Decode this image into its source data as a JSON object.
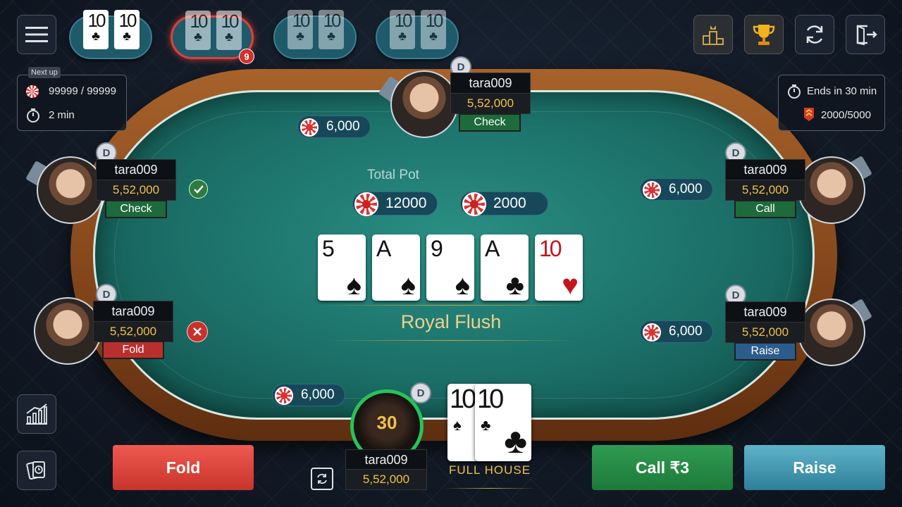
{
  "top_bar": {
    "menu_icon": "hamburger-menu-icon",
    "hands": [
      {
        "cards": [
          {
            "rank": "10",
            "suit": "♣"
          },
          {
            "rank": "10",
            "suit": "♣"
          }
        ],
        "state": "current"
      },
      {
        "cards": [
          {
            "rank": "10",
            "suit": "♣"
          },
          {
            "rank": "10",
            "suit": "♣"
          }
        ],
        "state": "alert",
        "badge": "9"
      },
      {
        "cards": [
          {
            "rank": "10",
            "suit": "♣"
          },
          {
            "rank": "10",
            "suit": "♣"
          }
        ],
        "state": "dim"
      },
      {
        "cards": [
          {
            "rank": "10",
            "suit": "♣"
          },
          {
            "rank": "10",
            "suit": "♣"
          }
        ],
        "state": "dim"
      }
    ],
    "right_icons": [
      "podium-icon",
      "trophy-icon",
      "refresh-icon",
      "exit-icon"
    ]
  },
  "next_up": {
    "label": "Next up",
    "blinds": "99999 / 99999",
    "time": "2 min"
  },
  "tournament": {
    "ends_in": "Ends in 30 min",
    "rank": "2000/5000"
  },
  "pot": {
    "label": "Total Pot",
    "main": "12000",
    "side": "2000"
  },
  "community_cards": [
    {
      "rank": "5",
      "suit": "♠",
      "color": "#111111"
    },
    {
      "rank": "A",
      "suit": "♠",
      "color": "#111111"
    },
    {
      "rank": "9",
      "suit": "♠",
      "color": "#111111"
    },
    {
      "rank": "A",
      "suit": "♣",
      "color": "#111111"
    },
    {
      "rank": "10",
      "suit": "♥",
      "color": "#c3151b"
    }
  ],
  "hand_result": "Royal Flush",
  "players": {
    "top": {
      "name": "tara009",
      "chips": "5,52,000",
      "action": "Check",
      "bet": "6,000",
      "dealer": "D"
    },
    "left_upper": {
      "name": "tara009",
      "chips": "5,52,000",
      "action": "Check",
      "dealer": "D",
      "status_icon": "checkmark-icon"
    },
    "left_lower": {
      "name": "tara009",
      "chips": "5,52,000",
      "action": "Fold",
      "dealer": "D",
      "status_icon": "close-icon"
    },
    "right_upper": {
      "name": "tara009",
      "chips": "5,52,000",
      "action": "Call",
      "bet": "6,000",
      "dealer": "D"
    },
    "right_lower": {
      "name": "tara009",
      "chips": "5,52,000",
      "action": "Raise",
      "bet": "6,000",
      "dealer": "D"
    },
    "hero": {
      "name": "tara009",
      "chips": "5,52,000",
      "timer": "30",
      "bet": "6,000",
      "dealer": "D",
      "hand_label": "FULL HOUSE",
      "cards": [
        {
          "rank": "10",
          "suit": "♠"
        },
        {
          "rank": "10",
          "suit": "♣"
        }
      ]
    }
  },
  "actions": {
    "fold": "Fold",
    "call": "Call ₹3",
    "raise": "Raise"
  },
  "side_tools": [
    "stats-chart-icon",
    "hand-history-icon",
    "rotate-seat-icon"
  ]
}
